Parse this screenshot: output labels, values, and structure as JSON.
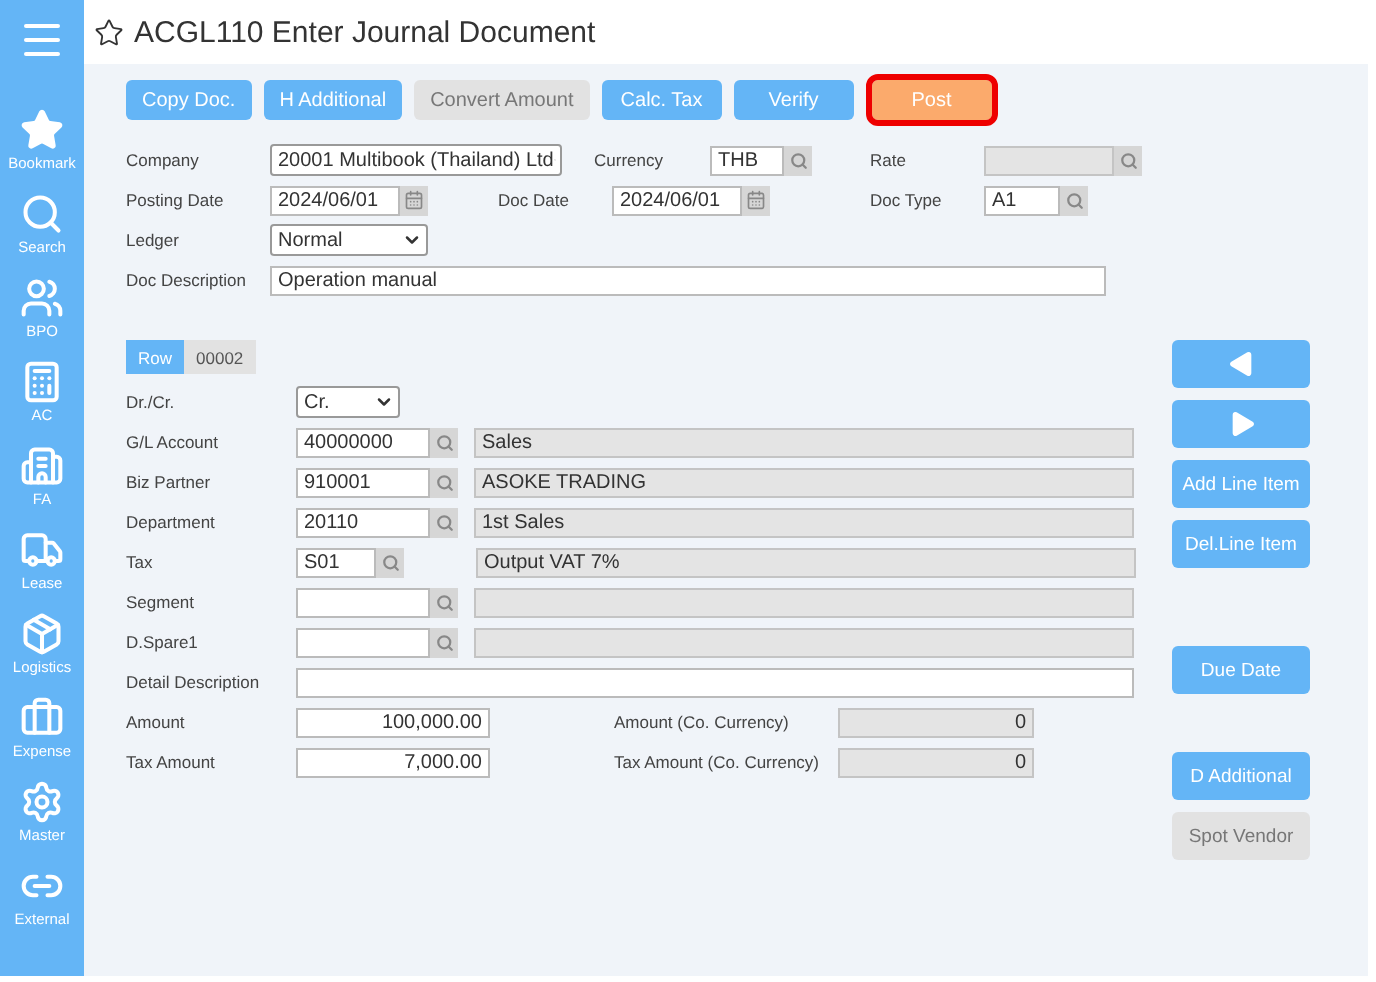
{
  "sidebar": {
    "items": [
      {
        "label": "Bookmark"
      },
      {
        "label": "Search"
      },
      {
        "label": "BPO"
      },
      {
        "label": "AC"
      },
      {
        "label": "FA"
      },
      {
        "label": "Lease"
      },
      {
        "label": "Logistics"
      },
      {
        "label": "Expense"
      },
      {
        "label": "Master"
      },
      {
        "label": "External"
      }
    ]
  },
  "window": {
    "title": "ACGL110 Enter Journal Document"
  },
  "toolbar": [
    {
      "label": "Copy Doc.",
      "disabled": false,
      "highlighted": false
    },
    {
      "label": "H Additional",
      "disabled": false,
      "highlighted": false
    },
    {
      "label": "Convert Amount",
      "disabled": true,
      "highlighted": false
    },
    {
      "label": "Calc. Tax",
      "disabled": false,
      "highlighted": false
    },
    {
      "label": "Verify",
      "disabled": false,
      "highlighted": false
    },
    {
      "label": "Post",
      "disabled": false,
      "highlighted": true
    }
  ],
  "header": {
    "rows": [
      [
        {
          "label": "Company",
          "kind": "select",
          "value": "20001 Multibook (Thailand) Ltd"
        },
        {
          "label": "Currency",
          "kind": "lookup",
          "value": "THB",
          "disabled": false
        },
        {
          "label": "Rate",
          "kind": "lookup",
          "disabled": true
        }
      ],
      [
        {
          "label": "Posting Date",
          "kind": "date",
          "value": "2024/06/01"
        },
        {
          "label": "Doc Date",
          "kind": "date",
          "value": "2024/06/01"
        },
        {
          "label": "Doc Type",
          "kind": "lookup",
          "value": "A1",
          "disabled": false
        }
      ],
      [
        {
          "label": "Ledger",
          "kind": "select",
          "value": "Normal"
        }
      ],
      [
        {
          "label": "Doc Description",
          "kind": "text",
          "value": "Operation manual"
        }
      ]
    ]
  },
  "row_tabs": [
    {
      "label": "Row",
      "selected": true
    },
    {
      "label": "00002",
      "selected": false
    }
  ],
  "detail": {
    "fields": [
      {
        "label": "Dr./Cr.",
        "kind": "select",
        "value": "Cr."
      },
      {
        "label": "G/L Account",
        "kind": "lookup",
        "value": "40000000",
        "description": "Sales"
      },
      {
        "label": "Biz Partner",
        "kind": "lookup",
        "value": "910001",
        "description": "ASOKE TRADING"
      },
      {
        "label": "Department",
        "kind": "lookup",
        "value": "20110",
        "description": "1st Sales"
      },
      {
        "label": "Tax",
        "kind": "short_lookup",
        "value": "S01",
        "description": "Output VAT 7%"
      },
      {
        "label": "Segment",
        "kind": "lookup"
      },
      {
        "label": "D.Spare1",
        "kind": "lookup"
      },
      {
        "label": "Detail Description",
        "kind": "text"
      },
      {
        "label": "Amount",
        "kind": "amount",
        "value": "100,000.00",
        "label_2": "Amount (Co. Currency)",
        "value_2": "0"
      },
      {
        "label": "Tax Amount",
        "kind": "amount",
        "value": "7,000.00",
        "label_2": "Tax Amount (Co. Currency)",
        "value_2": "0"
      }
    ]
  },
  "side_buttons": [
    [
      {
        "kind": "prev",
        "disabled": false
      },
      {
        "kind": "next",
        "disabled": false
      },
      {
        "kind": "text",
        "label": "Add Line Item",
        "disabled": false
      },
      {
        "kind": "text",
        "label": "Del.Line Item",
        "disabled": false
      }
    ],
    [
      {
        "kind": "text",
        "label": "Due Date",
        "disabled": false
      }
    ],
    [
      {
        "kind": "text",
        "label": "D Additional",
        "disabled": false
      },
      {
        "kind": "text",
        "label": "Spot Vendor",
        "disabled": true
      }
    ]
  ]
}
